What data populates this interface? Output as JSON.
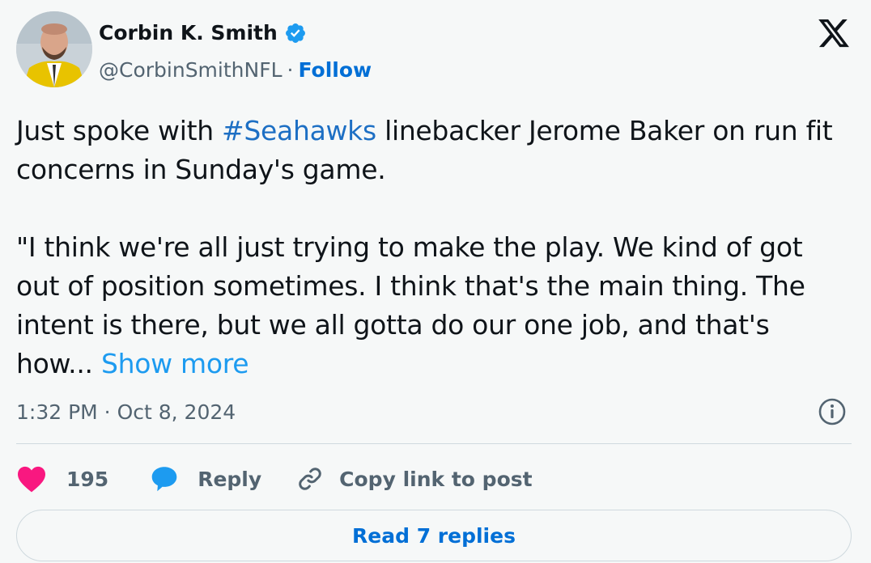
{
  "author": {
    "display_name": "Corbin K. Smith",
    "handle": "@CorbinSmithNFL",
    "separator": "·",
    "follow_label": "Follow",
    "verified": true
  },
  "tweet": {
    "line1_before": "Just spoke with ",
    "hashtag": "#Seahawks",
    "line1_after": " linebacker Jerome Baker on run fit concerns in Sunday's game.",
    "quote": "\"I think we're all just trying to make the play. We kind of got out of position sometimes. I think that's the main thing. The intent is there, but we all gotta do our one job, and that's how...",
    "show_more": "Show more"
  },
  "meta": {
    "timestamp": "1:32 PM · Oct 8, 2024"
  },
  "actions": {
    "likes": "195",
    "reply": "Reply",
    "copy_link": "Copy link to post"
  },
  "footer": {
    "read_replies": "Read 7 replies"
  },
  "colors": {
    "link": "#006fd6",
    "hashtag": "#1d6fc4",
    "heart": "#f91880",
    "reply_bubble": "#1d9bf0",
    "verified": "#1d9bf0"
  }
}
